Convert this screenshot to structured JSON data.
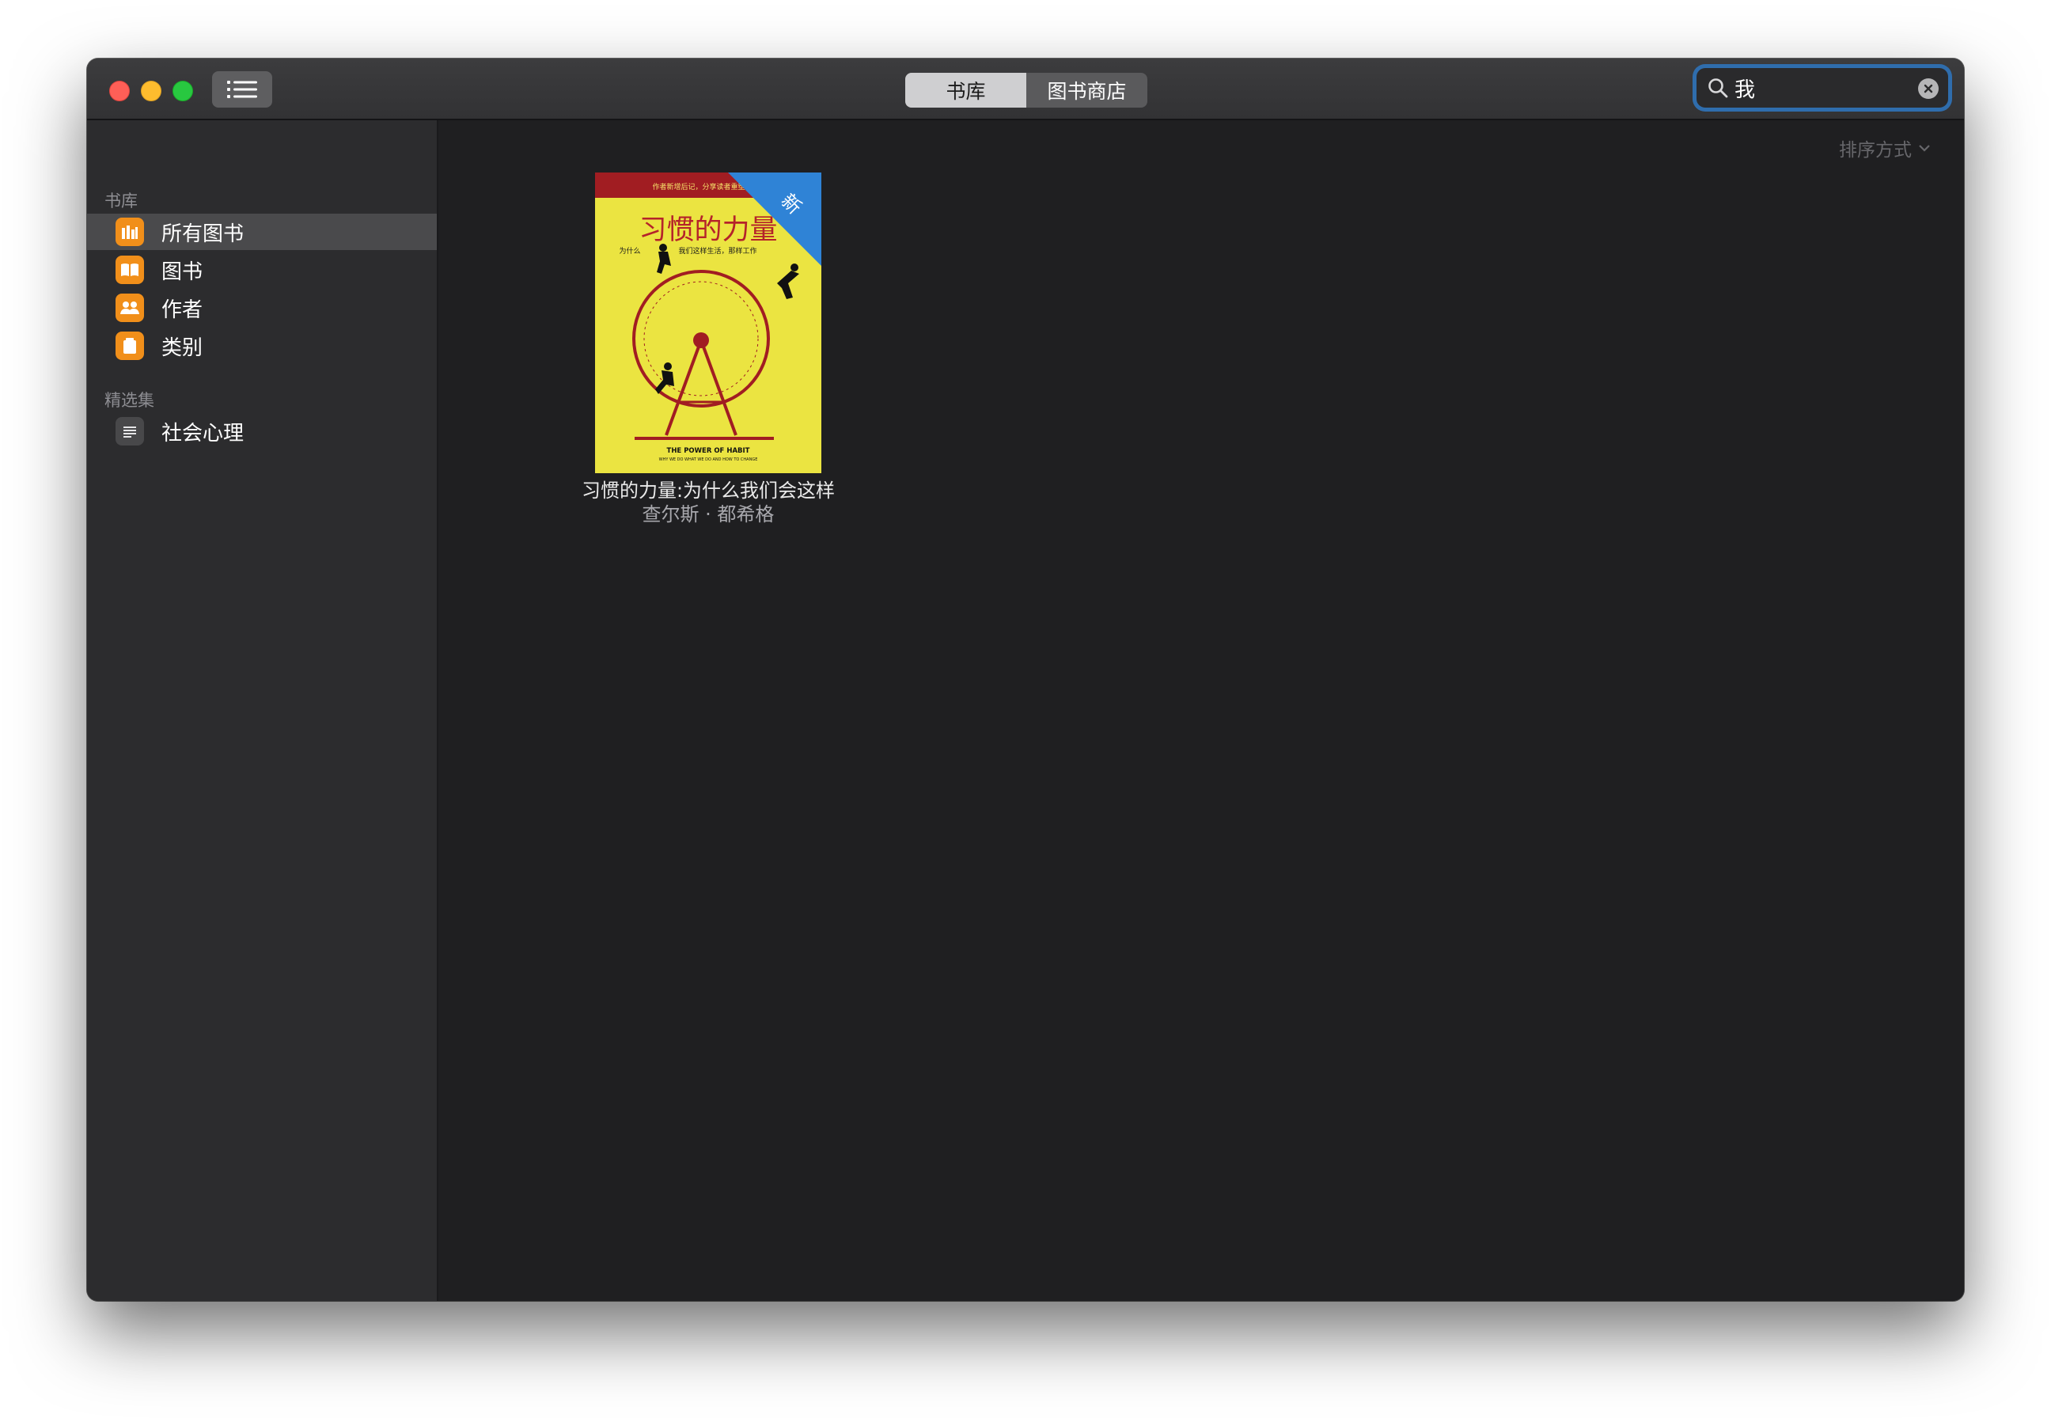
{
  "toolbar": {
    "segments": [
      "书库",
      "图书商店"
    ],
    "search_value": "我"
  },
  "sidebar": {
    "library_header": "书库",
    "items": [
      {
        "label": "所有图书",
        "icon": "bar-chart-icon"
      },
      {
        "label": "图书",
        "icon": "open-book-icon"
      },
      {
        "label": "作者",
        "icon": "people-icon"
      },
      {
        "label": "类别",
        "icon": "category-box-icon"
      }
    ],
    "collections_header": "精选集",
    "collections": [
      {
        "label": "社会心理",
        "icon": "list-icon"
      }
    ]
  },
  "main": {
    "sort_label": "排序方式",
    "books": [
      {
        "title": "习惯的力量:为什么我们会这样",
        "author": "查尔斯 · 都希格",
        "badge": "新",
        "cover": {
          "top_banner": "作者新增后记，分享读者重塑习惯",
          "title": "习惯的力量",
          "subtitle_left": "为什么",
          "subtitle_right": "我们这样生活，那样工作",
          "english_title": "THE POWER OF HABIT",
          "english_subtitle": "WHY WE DO WHAT WE DO AND HOW TO CHANGE",
          "background_color": "#ebe441",
          "accent_color": "#a11d22"
        }
      }
    ]
  },
  "colors": {
    "accent_orange": "#f18f1a",
    "search_focus_ring": "#2f6dad"
  }
}
